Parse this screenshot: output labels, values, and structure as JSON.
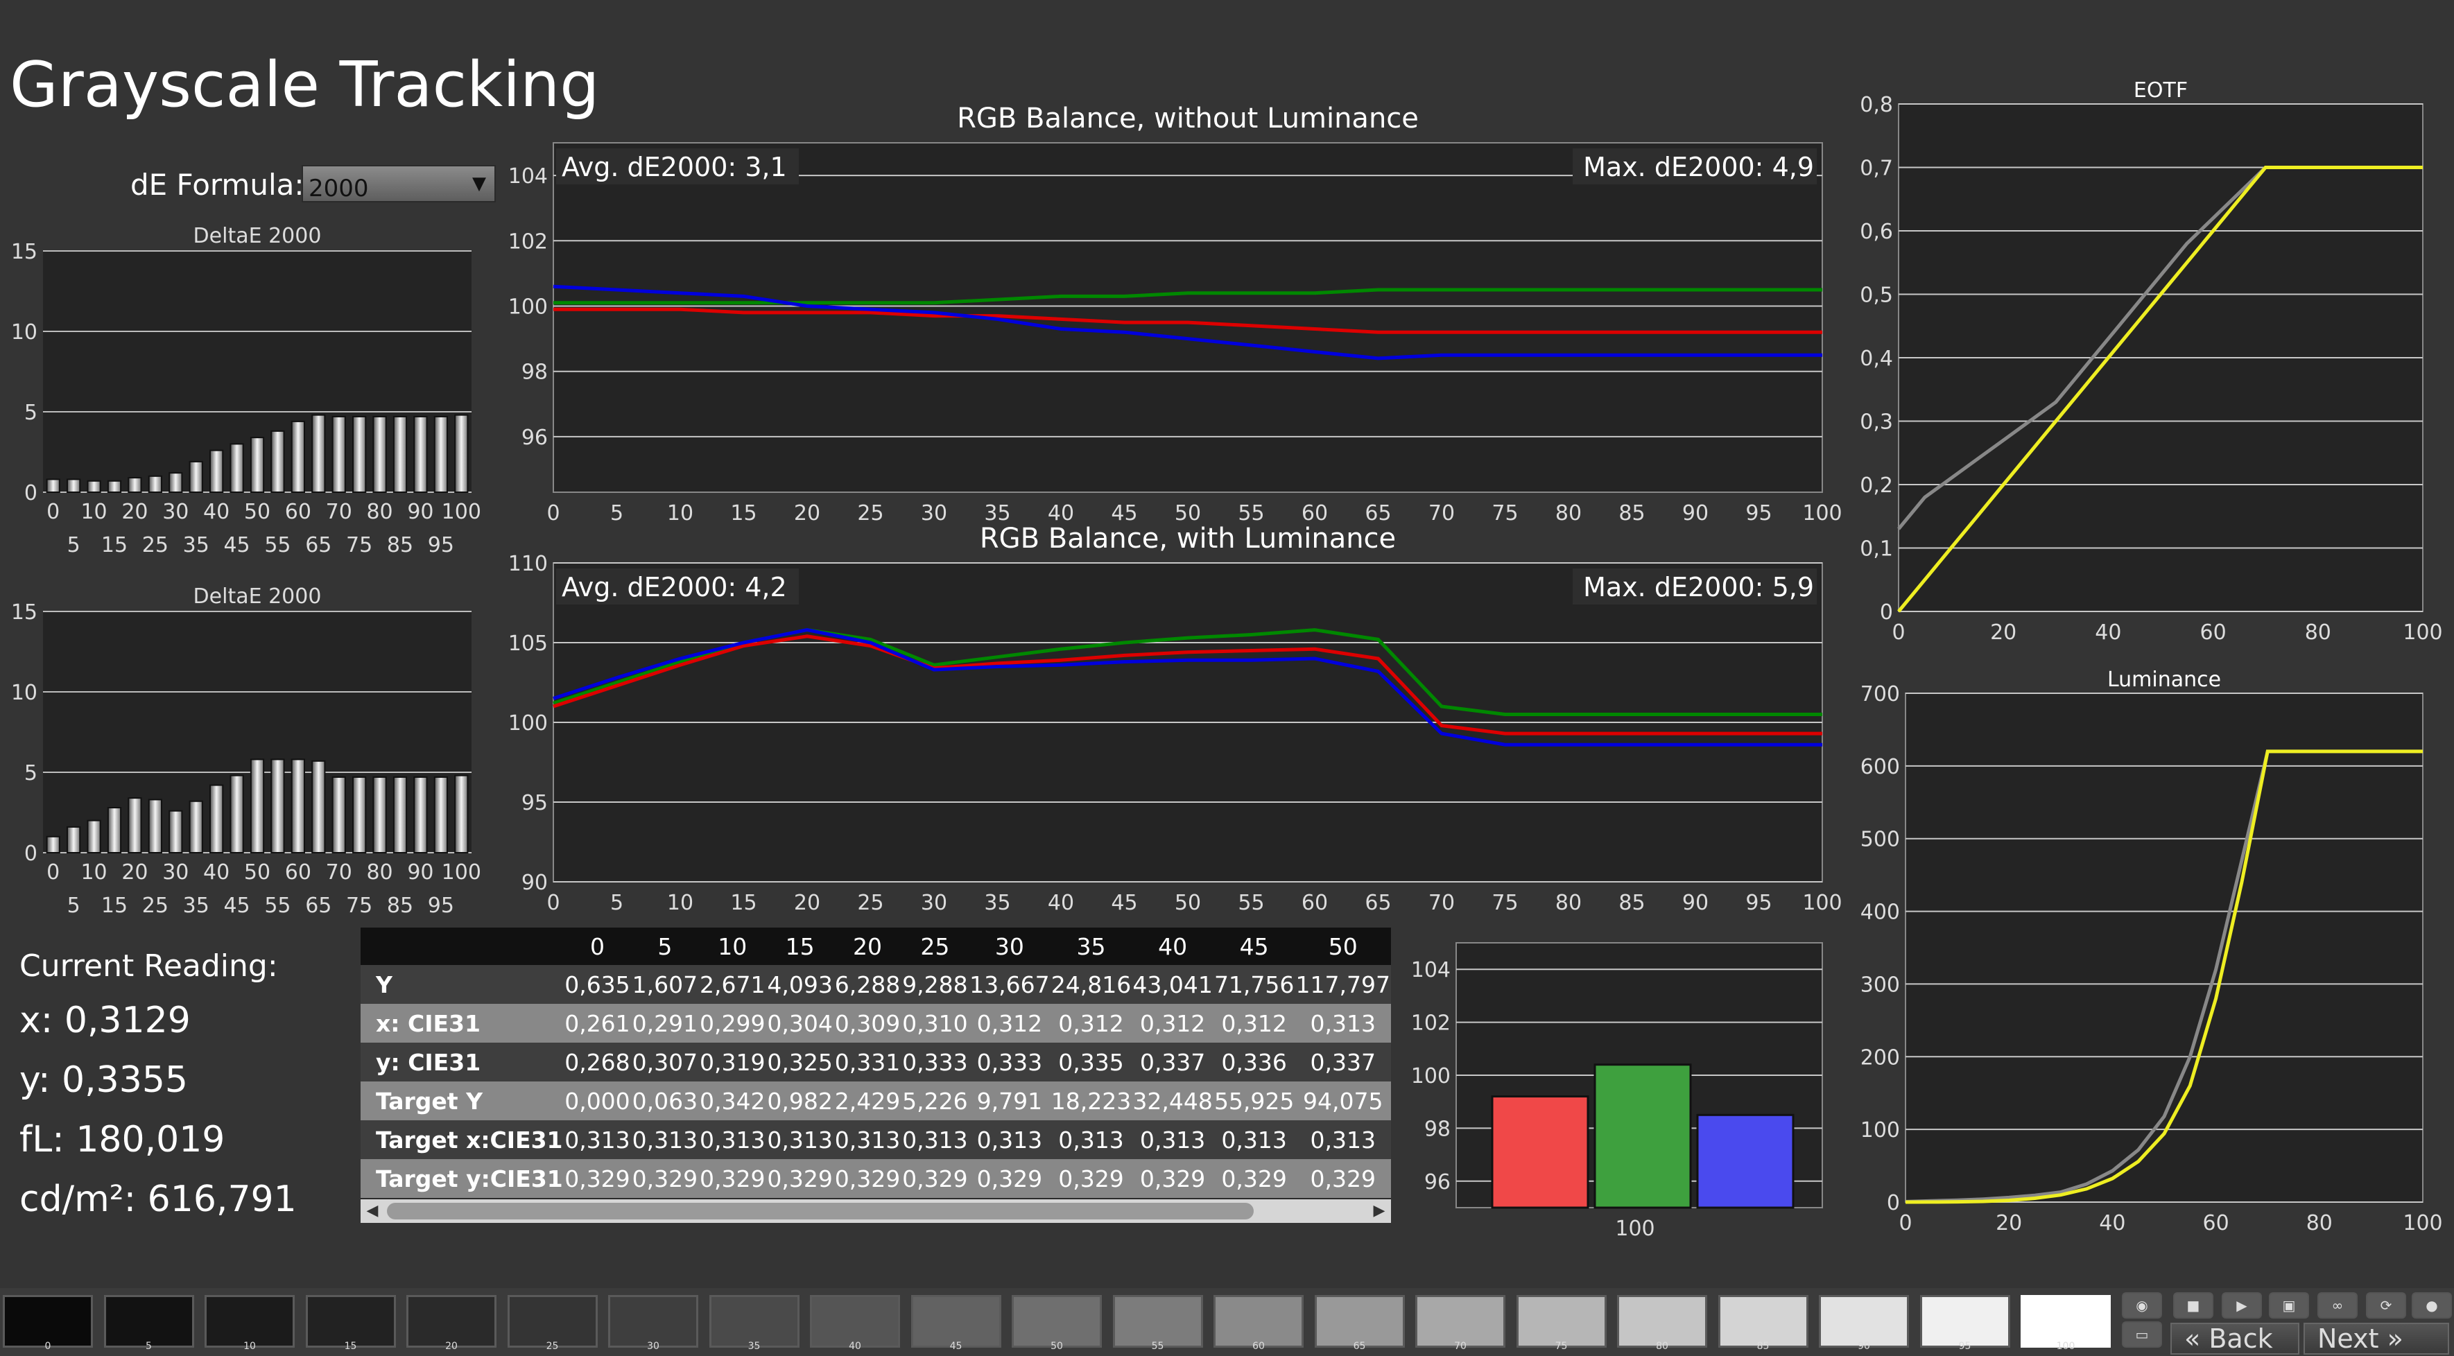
{
  "page": {
    "title": "Grayscale Tracking"
  },
  "formula": {
    "label": "dE Formula:",
    "value": "2000"
  },
  "current_reading": {
    "title": "Current Reading:",
    "x": "x: 0,3129",
    "y": "y: 0,3355",
    "fl": "fL: 180,019",
    "cdm2": "cd/m²: 616,791"
  },
  "table": {
    "headers": [
      "",
      "0",
      "5",
      "10",
      "15",
      "20",
      "25",
      "30",
      "35",
      "40",
      "45",
      "50"
    ],
    "rows": [
      {
        "label": "Y",
        "values": [
          "0,635",
          "1,607",
          "2,671",
          "4,093",
          "6,288",
          "9,288",
          "13,667",
          "24,816",
          "43,041",
          "71,756",
          "117,797"
        ]
      },
      {
        "label": "x: CIE31",
        "values": [
          "0,261",
          "0,291",
          "0,299",
          "0,304",
          "0,309",
          "0,310",
          "0,312",
          "0,312",
          "0,312",
          "0,312",
          "0,313"
        ]
      },
      {
        "label": "y: CIE31",
        "values": [
          "0,268",
          "0,307",
          "0,319",
          "0,325",
          "0,331",
          "0,333",
          "0,333",
          "0,335",
          "0,337",
          "0,336",
          "0,337"
        ]
      },
      {
        "label": "Target Y",
        "values": [
          "0,000",
          "0,063",
          "0,342",
          "0,982",
          "2,429",
          "5,226",
          "9,791",
          "18,223",
          "32,448",
          "55,925",
          "94,075"
        ]
      },
      {
        "label": "Target x:CIE31",
        "values": [
          "0,313",
          "0,313",
          "0,313",
          "0,313",
          "0,313",
          "0,313",
          "0,313",
          "0,313",
          "0,313",
          "0,313",
          "0,313"
        ]
      },
      {
        "label": "Target y:CIE31",
        "values": [
          "0,329",
          "0,329",
          "0,329",
          "0,329",
          "0,329",
          "0,329",
          "0,329",
          "0,329",
          "0,329",
          "0,329",
          "0,329"
        ]
      }
    ]
  },
  "patches": {
    "labels": [
      "0",
      "5",
      "10",
      "15",
      "20",
      "25",
      "30",
      "35",
      "40",
      "45",
      "50",
      "55",
      "60",
      "65",
      "70",
      "75",
      "80",
      "85",
      "90",
      "95",
      "100"
    ],
    "colors": [
      "#0a0a0a",
      "#121212",
      "#1b1b1b",
      "#222222",
      "#2a2a2a",
      "#343434",
      "#3e3e3e",
      "#4a4a4a",
      "#555555",
      "#626262",
      "#6f6f6f",
      "#7c7c7c",
      "#8a8a8a",
      "#999999",
      "#a8a8a8",
      "#b6b6b6",
      "#c5c5c5",
      "#d4d4d4",
      "#e2e2e2",
      "#f0f0f0",
      "#ffffff"
    ],
    "selected": "100"
  },
  "nav": {
    "back": "Back",
    "next": "Next"
  },
  "controls": {
    "icons": [
      "eye-icon",
      "stop-icon",
      "play-icon",
      "save-icon",
      "link-icon",
      "refresh-icon",
      "circle-icon",
      "screen-icon"
    ]
  },
  "chart_data": [
    {
      "id": "deltae-top",
      "type": "bar",
      "title": "DeltaE 2000",
      "categories": [
        0,
        5,
        10,
        15,
        20,
        25,
        30,
        35,
        40,
        45,
        50,
        55,
        60,
        65,
        70,
        75,
        80,
        85,
        90,
        95,
        100
      ],
      "values": [
        0.8,
        0.8,
        0.7,
        0.7,
        0.9,
        1.0,
        1.2,
        1.9,
        2.6,
        3.0,
        3.4,
        3.8,
        4.4,
        4.8,
        4.7,
        4.7,
        4.7,
        4.7,
        4.7,
        4.7,
        4.8
      ],
      "ylim": [
        0,
        15
      ],
      "yticks": [
        0,
        5,
        10,
        15
      ],
      "xticks_row1": [
        0,
        10,
        20,
        30,
        40,
        50,
        60,
        70,
        80,
        90,
        100
      ],
      "xticks_row2": [
        5,
        15,
        25,
        35,
        45,
        55,
        65,
        75,
        85,
        95
      ]
    },
    {
      "id": "deltae-bottom",
      "type": "bar",
      "title": "DeltaE 2000",
      "categories": [
        0,
        5,
        10,
        15,
        20,
        25,
        30,
        35,
        40,
        45,
        50,
        55,
        60,
        65,
        70,
        75,
        80,
        85,
        90,
        95,
        100
      ],
      "values": [
        1.0,
        1.6,
        2.0,
        2.8,
        3.4,
        3.3,
        2.6,
        3.2,
        4.2,
        4.8,
        5.8,
        5.8,
        5.8,
        5.7,
        4.7,
        4.7,
        4.7,
        4.7,
        4.7,
        4.7,
        4.8
      ],
      "ylim": [
        0,
        15
      ],
      "yticks": [
        0,
        5,
        10,
        15
      ],
      "xticks_row1": [
        0,
        10,
        20,
        30,
        40,
        50,
        60,
        70,
        80,
        90,
        100
      ],
      "xticks_row2": [
        5,
        15,
        25,
        35,
        45,
        55,
        65,
        75,
        85,
        95
      ]
    },
    {
      "id": "rgb-without",
      "type": "line",
      "title": "RGB Balance, without Luminance",
      "avg_label": "Avg. dE2000: 3,1",
      "max_label": "Max. dE2000: 4,9",
      "x": [
        0,
        5,
        10,
        15,
        20,
        25,
        30,
        35,
        40,
        45,
        50,
        55,
        60,
        65,
        70,
        75,
        80,
        85,
        90,
        95,
        100
      ],
      "ylim": [
        94.3,
        105
      ],
      "yticks": [
        96,
        98,
        100,
        102,
        104
      ],
      "series": [
        {
          "color": "#008800",
          "values": [
            100.1,
            100.1,
            100.1,
            100.1,
            100.1,
            100.1,
            100.1,
            100.2,
            100.3,
            100.3,
            100.4,
            100.4,
            100.4,
            100.5,
            100.5,
            100.5,
            100.5,
            100.5,
            100.5,
            100.5,
            100.5
          ]
        },
        {
          "color": "#dd0000",
          "values": [
            99.9,
            99.9,
            99.9,
            99.8,
            99.8,
            99.8,
            99.7,
            99.7,
            99.6,
            99.5,
            99.5,
            99.4,
            99.3,
            99.2,
            99.2,
            99.2,
            99.2,
            99.2,
            99.2,
            99.2,
            99.2
          ]
        },
        {
          "color": "#0000dd",
          "values": [
            100.6,
            100.5,
            100.4,
            100.3,
            100.0,
            99.9,
            99.8,
            99.6,
            99.3,
            99.2,
            99.0,
            98.8,
            98.6,
            98.4,
            98.5,
            98.5,
            98.5,
            98.5,
            98.5,
            98.5,
            98.5
          ]
        }
      ]
    },
    {
      "id": "rgb-with",
      "type": "line",
      "title": "RGB Balance, with Luminance",
      "avg_label": "Avg. dE2000: 4,2",
      "max_label": "Max. dE2000: 5,9",
      "x": [
        0,
        5,
        10,
        15,
        20,
        25,
        30,
        35,
        40,
        45,
        50,
        55,
        60,
        65,
        70,
        75,
        80,
        85,
        90,
        95,
        100
      ],
      "ylim": [
        90,
        110
      ],
      "yticks": [
        90,
        95,
        100,
        105,
        110
      ],
      "series": [
        {
          "color": "#008800",
          "values": [
            101.2,
            102.5,
            103.8,
            105.0,
            105.8,
            105.2,
            103.6,
            104.1,
            104.6,
            105.0,
            105.3,
            105.5,
            105.8,
            105.2,
            101.0,
            100.5,
            100.5,
            100.5,
            100.5,
            100.5,
            100.5
          ]
        },
        {
          "color": "#dd0000",
          "values": [
            101.0,
            102.3,
            103.6,
            104.8,
            105.4,
            104.8,
            103.4,
            103.7,
            103.9,
            104.2,
            104.4,
            104.5,
            104.6,
            104.0,
            99.8,
            99.3,
            99.3,
            99.3,
            99.3,
            99.3,
            99.3
          ]
        },
        {
          "color": "#0000dd",
          "values": [
            101.5,
            102.8,
            104.0,
            105.0,
            105.8,
            105.0,
            103.3,
            103.5,
            103.6,
            103.8,
            103.9,
            103.9,
            104.0,
            103.2,
            99.3,
            98.6,
            98.6,
            98.6,
            98.6,
            98.6,
            98.6
          ]
        }
      ]
    },
    {
      "id": "rgb-bar",
      "type": "bar",
      "categories": [
        "100"
      ],
      "series": [
        {
          "color": "#f04848",
          "value": 99.2
        },
        {
          "color": "#3ea03e",
          "value": 100.4
        },
        {
          "color": "#4a4aee",
          "value": 98.5
        }
      ],
      "ylim": [
        95,
        105
      ],
      "yticks": [
        96,
        98,
        100,
        102,
        104
      ]
    },
    {
      "id": "eotf",
      "type": "line",
      "title": "EOTF",
      "xlim": [
        0,
        100
      ],
      "ylim": [
        0,
        0.8
      ],
      "xticks": [
        0,
        20,
        40,
        60,
        80,
        100
      ],
      "yticks": [
        "0",
        "0,1",
        "0,2",
        "0,3",
        "0,4",
        "0,5",
        "0,6",
        "0,7",
        "0,8"
      ],
      "ytick_values": [
        0,
        0.1,
        0.2,
        0.3,
        0.4,
        0.5,
        0.6,
        0.7,
        0.8
      ],
      "series": [
        {
          "color": "#888888",
          "x": [
            0,
            5,
            10,
            15,
            20,
            25,
            30,
            35,
            40,
            45,
            50,
            55,
            60,
            65,
            70,
            75,
            80,
            85,
            90,
            95,
            100
          ],
          "values": [
            0.13,
            0.18,
            0.21,
            0.24,
            0.27,
            0.3,
            0.33,
            0.38,
            0.43,
            0.48,
            0.53,
            0.58,
            0.62,
            0.66,
            0.7,
            0.7,
            0.7,
            0.7,
            0.7,
            0.7,
            0.7
          ]
        },
        {
          "color": "#eeee22",
          "x": [
            0,
            5,
            10,
            15,
            20,
            25,
            30,
            35,
            40,
            45,
            50,
            55,
            60,
            65,
            70,
            75,
            80,
            85,
            90,
            95,
            100
          ],
          "values": [
            0.0,
            0.05,
            0.1,
            0.15,
            0.2,
            0.25,
            0.3,
            0.35,
            0.4,
            0.45,
            0.5,
            0.55,
            0.6,
            0.65,
            0.7,
            0.7,
            0.7,
            0.7,
            0.7,
            0.7,
            0.7
          ]
        }
      ]
    },
    {
      "id": "luminance",
      "type": "line",
      "title": "Luminance",
      "xlim": [
        0,
        100
      ],
      "ylim": [
        0,
        700
      ],
      "xticks": [
        0,
        20,
        40,
        60,
        80,
        100
      ],
      "yticks": [
        0,
        100,
        200,
        300,
        400,
        500,
        600,
        700
      ],
      "series": [
        {
          "color": "#888888",
          "x": [
            0,
            5,
            10,
            15,
            20,
            25,
            30,
            35,
            40,
            45,
            50,
            55,
            60,
            65,
            70,
            75,
            80,
            85,
            90,
            95,
            100
          ],
          "values": [
            0.6,
            1.6,
            2.7,
            4.1,
            6.3,
            9.3,
            13.7,
            24.8,
            43.0,
            71.8,
            117.8,
            200,
            320,
            470,
            620,
            620,
            620,
            620,
            620,
            620,
            620
          ]
        },
        {
          "color": "#eeee22",
          "x": [
            0,
            5,
            10,
            15,
            20,
            25,
            30,
            35,
            40,
            45,
            50,
            55,
            60,
            65,
            70,
            75,
            80,
            85,
            90,
            95,
            100
          ],
          "values": [
            0,
            0.06,
            0.34,
            0.98,
            2.43,
            5.23,
            9.79,
            18.2,
            32.4,
            55.9,
            94.1,
            160,
            280,
            440,
            620,
            620,
            620,
            620,
            620,
            620,
            620
          ]
        }
      ]
    }
  ]
}
